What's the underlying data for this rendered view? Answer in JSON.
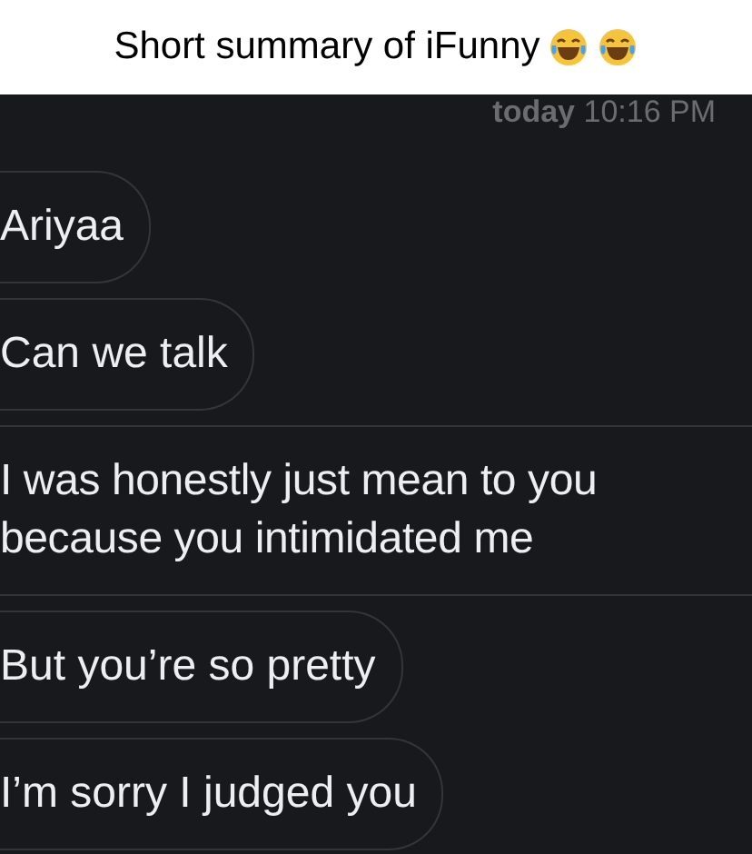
{
  "caption": "Short summary of iFunny",
  "timestamp": {
    "day": "today",
    "time": "10:16 PM"
  },
  "messages": [
    {
      "text": "Ariyaa"
    },
    {
      "text": "Can we talk"
    },
    {
      "text": "I was honestly just mean to you because you intimidated me"
    },
    {
      "text": "But you’re so pretty"
    },
    {
      "text": "I’m sorry I judged you"
    }
  ]
}
